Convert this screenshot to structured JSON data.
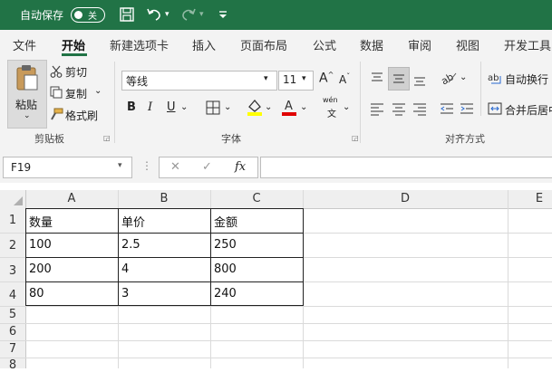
{
  "titlebar": {
    "autosave_label": "自动保存",
    "autosave_state": "关"
  },
  "tabs": [
    "文件",
    "开始",
    "新建选项卡",
    "插入",
    "页面布局",
    "公式",
    "数据",
    "审阅",
    "视图",
    "开发工具"
  ],
  "ribbon": {
    "clipboard": {
      "paste": "粘贴",
      "cut": "剪切",
      "copy": "复制",
      "format_painter": "格式刷",
      "group": "剪贴板"
    },
    "font": {
      "name": "等线",
      "size": "11",
      "bold": "B",
      "italic": "I",
      "underline": "U",
      "group": "字体",
      "phonetic": "wén"
    },
    "alignment": {
      "wrap": "自动换行",
      "merge": "合并后居中",
      "group": "对齐方式"
    }
  },
  "formula_bar": {
    "name_box": "F19",
    "cancel": "✕",
    "enter": "✓",
    "fx": "fx",
    "value": ""
  },
  "sheet": {
    "columns": [
      "A",
      "B",
      "C",
      "D",
      "E"
    ],
    "rows": [
      "1",
      "2",
      "3",
      "4",
      "5",
      "6",
      "7",
      "8"
    ],
    "cells": [
      [
        "数量",
        "单价",
        "金额"
      ],
      [
        "100",
        "2.5",
        "250"
      ],
      [
        "200",
        "4",
        "800"
      ],
      [
        "80",
        "3",
        "240"
      ]
    ]
  },
  "colors": {
    "accent": "#217346",
    "font_color": "#e00000",
    "highlight": "#ffff00"
  }
}
